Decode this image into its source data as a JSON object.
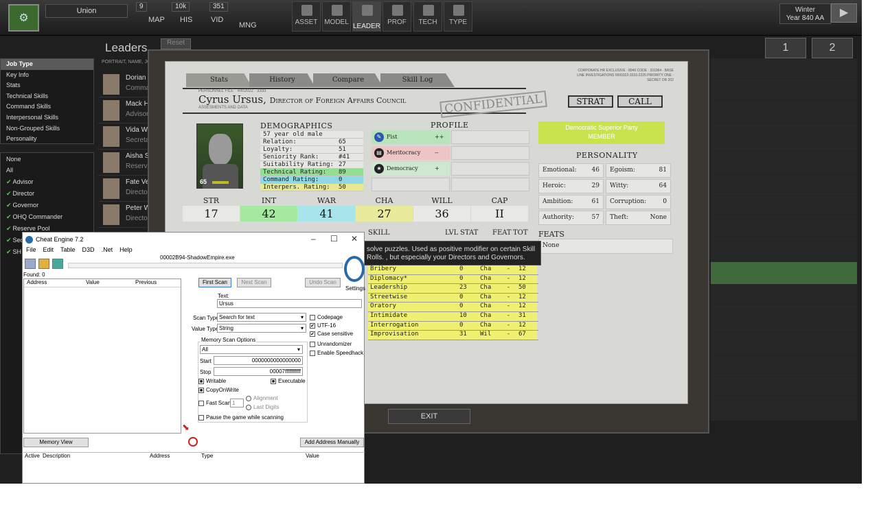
{
  "topbar": {
    "faction": "Union",
    "resources": [
      "9",
      "10k",
      "351"
    ],
    "nav": [
      "MAP",
      "HIS",
      "VID",
      "MNG"
    ],
    "bigbuttons": [
      "ASSET",
      "MODEL",
      "LEADER",
      "PROF",
      "TECH",
      "TYPE"
    ],
    "season": "Winter",
    "year": "Year 840 AA"
  },
  "leaders_title": "Leaders",
  "reset_label": "Reset",
  "portrait_header": "PORTRAIT, NAME, JO",
  "pages": [
    "1",
    "2"
  ],
  "filters": [
    "Job Type",
    "Key Info",
    "Stats",
    "Technical Skills",
    "Command Skills",
    "Interpersonal Skills",
    "Non-Grouped Skills",
    "Personality"
  ],
  "jobs": [
    "None",
    "All",
    "Advisor",
    "Director",
    "Governor",
    "OHQ Commander",
    "Reserve Pool",
    "Sec",
    "SH"
  ],
  "leaders": [
    {
      "name": "Dorian",
      "job": "Comma"
    },
    {
      "name": "Mack H",
      "job": "Advisor"
    },
    {
      "name": "Vida W",
      "job": "Secreta"
    },
    {
      "name": "Aisha S",
      "job": "Reserve"
    },
    {
      "name": "Fate Ve",
      "job": "Director"
    },
    {
      "name": "Peter W",
      "job": "Director"
    }
  ],
  "file": {
    "tabs": [
      "Stats",
      "History",
      "Compare",
      "Skill Log"
    ],
    "personnel_file": "PERSONNEL FILE · #002022 · 3333",
    "assess": "ASSESMENTS AND DATA",
    "name": "Cyrus Ursus",
    "title": "Director of Foreign Affairs Council",
    "confidential": "CONFIDENTIAL",
    "strat": "STRAT",
    "call": "CALL",
    "corpnote": "CORPORATE HR EXCLUSIVE · 8940 CODE · 331964 · BASE LINE INVESTIGATIONS 0000322-3333-2225 PRIORITY ONE · SECRET OR 202",
    "age": "65",
    "demographics": {
      "header": "DEMOGRAPHICS",
      "rows": [
        {
          "label": "57 year old male",
          "value": ""
        },
        {
          "label": "Relation:",
          "value": "65"
        },
        {
          "label": "Loyalty:",
          "value": "51"
        },
        {
          "label": "Seniority Rank:",
          "value": "#41"
        },
        {
          "label": "Suitability Rating:",
          "value": "27"
        },
        {
          "label": "Technical Rating:",
          "value": "89"
        },
        {
          "label": "Command Rating:",
          "value": "0"
        },
        {
          "label": "Interpers. Rating:",
          "value": "50"
        }
      ]
    },
    "profile": {
      "header": "PROFILE",
      "items": [
        {
          "label": "Fist",
          "mod": "++",
          "color": "#b9e3b9"
        },
        {
          "label": "Meritocracy",
          "mod": "--",
          "color": "#efc4c4"
        },
        {
          "label": "Democracy",
          "mod": "+",
          "color": "#cfe6cf"
        }
      ]
    },
    "party": {
      "name": "Democratic Superior Party",
      "status": "MEMBER"
    },
    "personality": {
      "header": "PERSONALITY",
      "cells": [
        {
          "label": "Emotional:",
          "value": "46"
        },
        {
          "label": "Egoism:",
          "value": "81"
        },
        {
          "label": "Heroic:",
          "value": "29"
        },
        {
          "label": "Witty:",
          "value": "64"
        },
        {
          "label": "Ambition:",
          "value": "61"
        },
        {
          "label": "Corruption:",
          "value": "0"
        },
        {
          "label": "Authority:",
          "value": "57"
        },
        {
          "label": "Theft:",
          "value": "None"
        }
      ]
    },
    "stats": [
      {
        "label": "STR",
        "value": "17",
        "color": "#e8e8e4"
      },
      {
        "label": "INT",
        "value": "42",
        "color": "#a7e8a0"
      },
      {
        "label": "WAR",
        "value": "41",
        "color": "#a8e4ec"
      },
      {
        "label": "CHA",
        "value": "27",
        "color": "#eaea9c"
      },
      {
        "label": "WILL",
        "value": "36",
        "color": "#e8e8e4"
      },
      {
        "label": "CAP",
        "value": "II",
        "color": "#e8e8e4"
      }
    ],
    "feats": {
      "header": "FEATS",
      "value": "None"
    },
    "skill_header": {
      "skill": "SKILL",
      "lvl": "LVL",
      "stat": "STAT",
      "feat": "FEAT",
      "tot": "TOT"
    },
    "skills": [
      {
        "name": "Bribery",
        "lvl": "0",
        "stat": "Cha",
        "feat": "-",
        "tot": "12"
      },
      {
        "name": "Diplomacy*",
        "lvl": "0",
        "stat": "Cha",
        "feat": "-",
        "tot": "12"
      },
      {
        "name": "Leadership",
        "lvl": "23",
        "stat": "Cha",
        "feat": "-",
        "tot": "50"
      },
      {
        "name": "Streetwise",
        "lvl": "0",
        "stat": "Cha",
        "feat": "-",
        "tot": "12"
      },
      {
        "name": "Oratory",
        "lvl": "0",
        "stat": "Cha",
        "feat": "-",
        "tot": "12"
      },
      {
        "name": "Intimidate",
        "lvl": "10",
        "stat": "Cha",
        "feat": "-",
        "tot": "31"
      },
      {
        "name": "Interrogation",
        "lvl": "0",
        "stat": "Cha",
        "feat": "-",
        "tot": "12"
      },
      {
        "name": "Improvisation",
        "lvl": "31",
        "stat": "Wil",
        "feat": "-",
        "tot": "67"
      }
    ],
    "tooltip": "solve puzzles. Used as positive modifier on certain Skill Rolls. , but especially your Directors and Governors.",
    "exit": "EXIT"
  },
  "cheat_engine": {
    "title": "Cheat Engine 7.2",
    "menu": [
      "File",
      "Edit",
      "Table",
      "D3D",
      ".Net",
      "Help"
    ],
    "process": "00002B94-ShadowEmpire.exe",
    "found": "Found: 0",
    "settings": "Settings",
    "list_cols": [
      "Address",
      "Value",
      "Previous"
    ],
    "first_scan": "First Scan",
    "next_scan": "Next Scan",
    "undo_scan": "Undo Scan",
    "text_label": "Text:",
    "text_value": "Ursus",
    "scan_type_label": "Scan Type",
    "scan_type": "Search for text",
    "value_type_label": "Value Type",
    "value_type": "String",
    "mem_opts": "Memory Scan Options",
    "region": "All",
    "start_label": "Start",
    "start": "0000000000000000",
    "stop_label": "Stop",
    "stop": "00007fffffffffff",
    "writable": "Writable",
    "executable": "Executable",
    "copyonwrite": "CopyOnWrite",
    "fastscan": "Fast Scan",
    "fastscan_val": "1",
    "alignment": "Alignment",
    "lastdigits": "Last Digits",
    "pause": "Pause the game while scanning",
    "codepage": "Codepage",
    "utf16": "UTF-16",
    "case": "Case sensitive",
    "unrandomizer": "Unrandomizer",
    "speedhack": "Enable Speedhack",
    "memory_view": "Memory View",
    "add_address": "Add Address Manually",
    "addr_cols": [
      "Active",
      "Description",
      "Address",
      "Type",
      "Value"
    ]
  }
}
